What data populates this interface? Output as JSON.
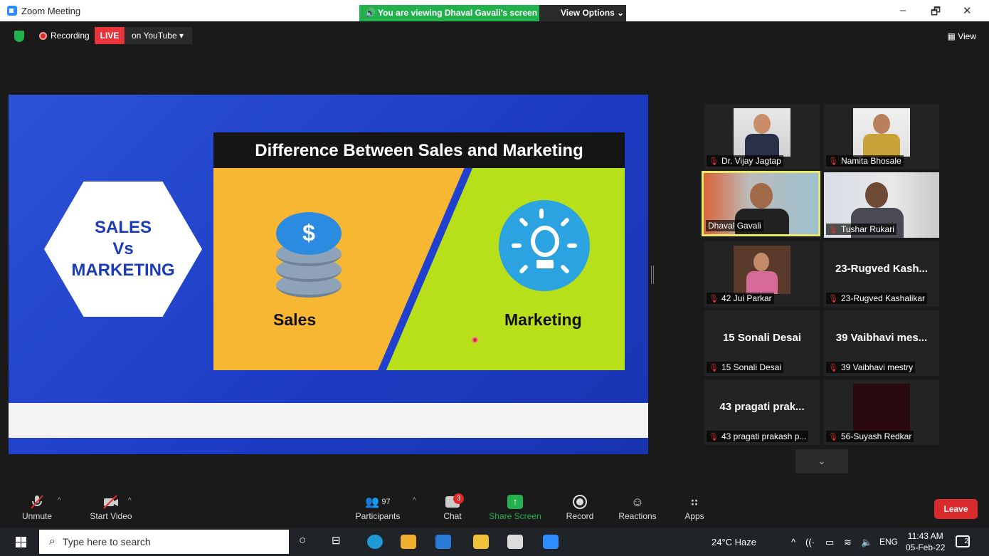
{
  "window": {
    "title": "Zoom Meeting",
    "minimize": "–",
    "restore": "🗗",
    "close": "✕"
  },
  "banner": {
    "viewing_text": "🔊 You are viewing Dhaval Gavali's screen",
    "view_options": "View Options ⌄"
  },
  "topbar": {
    "recording_label": "Recording",
    "live_label": "LIVE",
    "youtube_label": "on YouTube ▾",
    "view_label": "▦ View"
  },
  "slide": {
    "title": "Difference Between Sales and Marketing",
    "hex_line1": "SALES",
    "hex_line2": "Vs",
    "hex_line3": "MARKETING",
    "coin_symbol": "$",
    "left_label": "Sales",
    "right_label": "Marketing"
  },
  "participants": [
    {
      "name": "Dr. Vijay Jagtap",
      "muted": true,
      "has_video": true
    },
    {
      "name": "Namita Bhosale",
      "muted": true,
      "has_video": true
    },
    {
      "name": "Dhaval Gavali",
      "muted": false,
      "has_video": true,
      "active": true
    },
    {
      "name": "Tushar Rukari",
      "muted": true,
      "has_video": true
    },
    {
      "name": "42 Jui Parkar",
      "muted": true,
      "has_video": true
    },
    {
      "name": "23-Rugved Kashalikar",
      "display": "23-Rugved Kash...",
      "muted": true,
      "has_video": false
    },
    {
      "name": "15 Sonali Desai",
      "display": "15 Sonali Desai",
      "muted": true,
      "has_video": false
    },
    {
      "name": "39 Vaibhavi mestry",
      "display": "39 Vaibhavi mes...",
      "muted": true,
      "has_video": false
    },
    {
      "name": "43 pragati prakash p...",
      "display": "43 pragati prak...",
      "muted": true,
      "has_video": false
    },
    {
      "name": "56-Suyash Redkar",
      "muted": true,
      "has_video": true
    }
  ],
  "gallery": {
    "more_icon": "⌄"
  },
  "toolbar": {
    "unmute": "Unmute",
    "start_video": "Start Video",
    "participants": "Participants",
    "participants_count": "97",
    "chat": "Chat",
    "chat_badge": "3",
    "share_screen": "Share Screen",
    "record": "Record",
    "reactions": "Reactions",
    "apps": "Apps",
    "leave": "Leave"
  },
  "taskbar": {
    "search_placeholder": "Type here to search",
    "weather": "24°C  Haze",
    "lang": "ENG",
    "time": "11:43 AM",
    "date": "05-Feb-22",
    "notif_count": "2"
  },
  "colors": {
    "accent_green": "#22b14c",
    "live_red": "#e8343a",
    "zoom_blue": "#2d8cff",
    "active_border": "#e8e86a"
  }
}
